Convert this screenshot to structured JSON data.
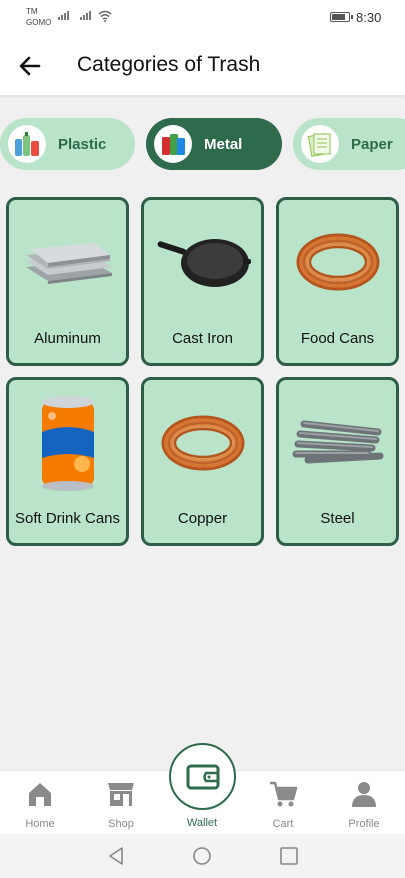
{
  "status_bar": {
    "carrier_line1": "TM",
    "carrier_line2": "GOMO",
    "time": "8:30"
  },
  "header": {
    "title": "Categories of Trash"
  },
  "categories": [
    {
      "label": "Plastic",
      "state": "inactive"
    },
    {
      "label": "Metal",
      "state": "active"
    },
    {
      "label": "Paper",
      "state": "inactive"
    }
  ],
  "items": [
    {
      "label": "Aluminum",
      "icon": "aluminum-sheets-image"
    },
    {
      "label": "Cast Iron",
      "icon": "frying-pan-image"
    },
    {
      "label": "Food Cans",
      "icon": "copper-wire-coil-image"
    },
    {
      "label": "Soft Drink Cans",
      "icon": "soda-can-image"
    },
    {
      "label": "Copper",
      "icon": "copper-wire-coil-image"
    },
    {
      "label": "Steel",
      "icon": "steel-rebar-image"
    }
  ],
  "bottom_nav": {
    "home": "Home",
    "shop": "Shop",
    "wallet": "Wallet",
    "cart": "Cart",
    "profile": "Profile"
  },
  "colors": {
    "primary": "#2e6b4c",
    "card_bg": "#b9e4c9",
    "card_border": "#2e5e47",
    "nav_inactive": "#8a8a8a"
  }
}
